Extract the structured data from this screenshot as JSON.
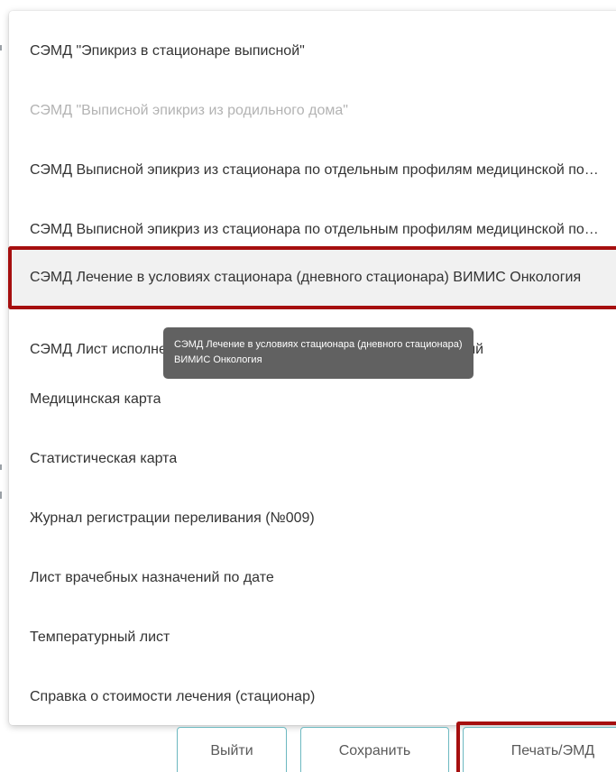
{
  "menu": {
    "items": [
      {
        "label": "СЭМД \"Эпикриз в стационаре выписной\"",
        "state": "normal"
      },
      {
        "label": "СЭМД \"Выписной эпикриз из родильного дома\"",
        "state": "disabled"
      },
      {
        "label": "СЭМД Выписной эпикриз из стационара по отдельным профилям медицинской помощи",
        "state": "normal"
      },
      {
        "label": "СЭМД Выписной эпикриз из стационара по отдельным профилям медицинской помощи",
        "state": "normal"
      },
      {
        "label": "СЭМД Лечение в условиях стационара (дневного стационара) ВИМИС Онкология",
        "state": "highlighted"
      },
      {
        "label": "СЭМД Лист исполнения (выполненных) лекарственных назначений",
        "state": "normal"
      },
      {
        "label": "Медицинская карта",
        "state": "normal"
      },
      {
        "label": "Статистическая карта",
        "state": "normal"
      },
      {
        "label": "Журнал регистрации переливания (№009)",
        "state": "normal"
      },
      {
        "label": "Лист врачебных назначений по дате",
        "state": "normal"
      },
      {
        "label": "Температурный лист",
        "state": "normal"
      },
      {
        "label": "Справка о стоимости лечения (стационар)",
        "state": "normal"
      }
    ]
  },
  "tooltip": {
    "text": "СЭМД Лечение в условиях стационара (дневного стационара) ВИМИС Онкология"
  },
  "buttons": {
    "exit": "Выйти",
    "save": "Сохранить",
    "print": "Печать/ЭМД"
  },
  "colors": {
    "highlight_frame": "#a60f0f",
    "button_border": "#6cb8c0",
    "tooltip_bg": "#616161",
    "disabled_text": "#b3b3b3"
  }
}
